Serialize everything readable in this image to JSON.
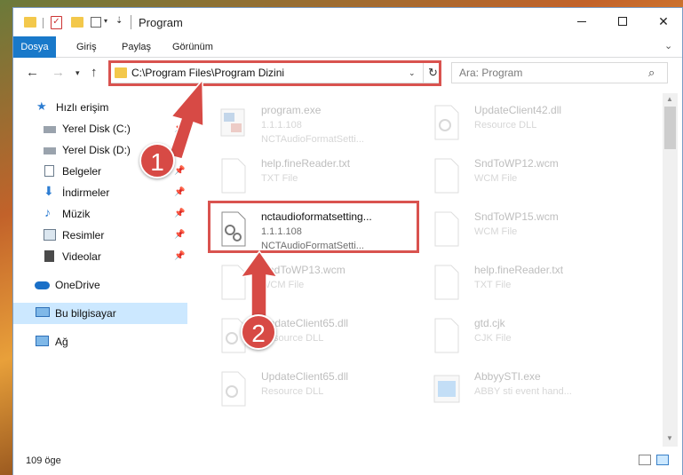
{
  "window": {
    "title": "Program",
    "controls": {
      "minimize": "—",
      "maximize": "☐",
      "close": "✕"
    }
  },
  "ribbon": {
    "tabs": [
      {
        "label": "Dosya"
      },
      {
        "label": "Giriş"
      },
      {
        "label": "Paylaş"
      },
      {
        "label": "Görünüm"
      }
    ]
  },
  "address": {
    "path": "C:\\Program Files\\Program Dizini",
    "search_placeholder": "Ara: Program"
  },
  "sidebar": {
    "items": [
      {
        "label": "Hızlı erişim"
      },
      {
        "label": "Yerel Disk (C:)"
      },
      {
        "label": "Yerel Disk (D:)"
      },
      {
        "label": "Belgeler"
      },
      {
        "label": "İndirmeler"
      },
      {
        "label": "Müzik"
      },
      {
        "label": "Resimler"
      },
      {
        "label": "Videolar"
      },
      {
        "label": "OneDrive"
      },
      {
        "label": "Bu bilgisayar"
      },
      {
        "label": "Ağ"
      }
    ]
  },
  "files": [
    {
      "name": "program.exe",
      "line2": "1.1.1.108",
      "line3": "NCTAudioFormatSetti..."
    },
    {
      "name": "UpdateClient42.dll",
      "line2": "Resource DLL",
      "line3": ""
    },
    {
      "name": "help.fineReader.txt",
      "line2": "TXT File",
      "line3": ""
    },
    {
      "name": "SndToWP12.wcm",
      "line2": "WCM File",
      "line3": ""
    },
    {
      "name": "nctaudioformatsetting...",
      "line2": "1.1.1.108",
      "line3": "NCTAudioFormatSetti..."
    },
    {
      "name": "SndToWP15.wcm",
      "line2": "WCM File",
      "line3": ""
    },
    {
      "name": "SndToWP13.wcm",
      "line2": "WCM File",
      "line3": ""
    },
    {
      "name": "help.fineReader.txt",
      "line2": "TXT File",
      "line3": ""
    },
    {
      "name": "UpdateClient65.dll",
      "line2": "Resource DLL",
      "line3": ""
    },
    {
      "name": "gtd.cjk",
      "line2": "CJK File",
      "line3": ""
    },
    {
      "name": "UpdateClient65.dll",
      "line2": "Resource DLL",
      "line3": ""
    },
    {
      "name": "AbbyySTI.exe",
      "line2": "ABBY sti event hand...",
      "line3": ""
    }
  ],
  "status": {
    "item_count": "109 öge"
  },
  "annotations": {
    "badge1": "1",
    "badge2": "2",
    "color": "#d9534f"
  }
}
